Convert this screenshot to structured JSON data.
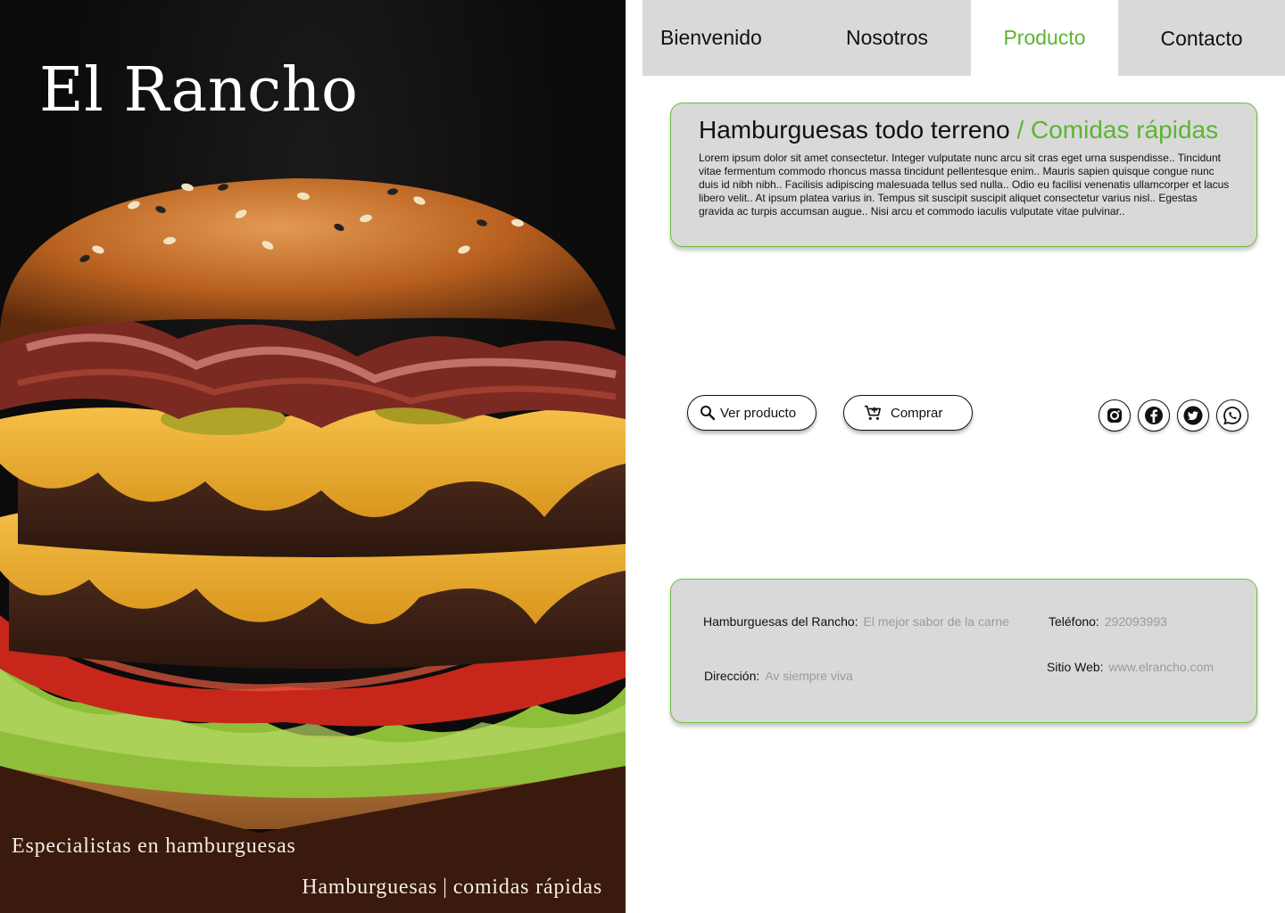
{
  "brand": {
    "name": "El Rancho",
    "tagline": "Especialistas en hamburguesas",
    "subtag_left": "Hamburguesas",
    "subtag_sep": "|",
    "subtag_right": "comidas rápidas"
  },
  "nav": {
    "items": [
      {
        "label": "Bienvenido",
        "active": false
      },
      {
        "label": "Nosotros",
        "active": false
      },
      {
        "label": "Producto",
        "active": true
      },
      {
        "label": "Contacto",
        "active": false
      }
    ]
  },
  "product": {
    "title": "Hamburguesas todo terreno",
    "title_accent": "/ Comidas rápidas",
    "description": "Lorem ipsum dolor sit amet consectetur. Integer vulputate nunc arcu sit cras eget urna suspendisse.. Tincidunt vitae fermentum commodo rhoncus massa tincidunt pellentesque enim.. Mauris sapien quisque congue nunc duis id nibh nibh.. Facilisis adipiscing malesuada tellus sed nulla.. Odio eu facilisi venenatis ullamcorper et lacus libero velit.. At ipsum platea varius in. Tempus sit suscipit suscipit aliquet consectetur varius nisl.. Egestas gravida ac turpis accumsan augue.. Nisi arcu et commodo iaculis vulputate vitae pulvinar.."
  },
  "actions": {
    "view_label": "Ver producto",
    "buy_label": "Comprar"
  },
  "socials": [
    "instagram-icon",
    "facebook-icon",
    "twitter-icon",
    "whatsapp-icon"
  ],
  "info": {
    "business_label": "Hamburguesas del Rancho:",
    "business_value": "El mejor sabor de la carne",
    "phone_label": "Teléfono:",
    "phone_value": "292093993",
    "address_label": "Dirección:",
    "address_value": "Av siempre viva",
    "website_label": "Sitio Web:",
    "website_value": "www.elrancho.com"
  },
  "colors": {
    "accent": "#5cb531",
    "card_bg": "#d9d9d9",
    "footer_brown": "#3a1a0c"
  }
}
